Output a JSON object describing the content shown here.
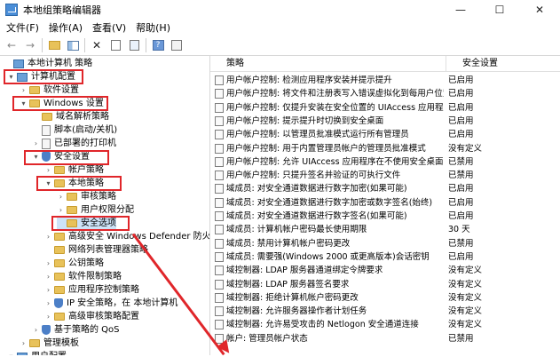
{
  "window": {
    "title": "本地组策略编辑器",
    "minimize": "—",
    "maximize": "☐",
    "close": "✕"
  },
  "menu": [
    "文件(F)",
    "操作(A)",
    "查看(V)",
    "帮助(H)"
  ],
  "toolbar_icons": [
    "back-arrow-icon",
    "forward-arrow-icon",
    "up-folder-icon",
    "show-hide-tree-icon",
    "delete-icon",
    "properties-icon",
    "refresh-icon",
    "help-icon",
    "filter-icon"
  ],
  "tree": [
    {
      "label": "本地计算机 策略",
      "indent": 0,
      "expander": "",
      "icon": "comp"
    },
    {
      "label": "计算机配置",
      "indent": 1,
      "expander": "▾",
      "icon": "comp"
    },
    {
      "label": "软件设置",
      "indent": 2,
      "expander": "›",
      "icon": "fold"
    },
    {
      "label": "Windows 设置",
      "indent": 2,
      "expander": "▾",
      "icon": "fold"
    },
    {
      "label": "域名解析策略",
      "indent": 3,
      "expander": "",
      "icon": "fold"
    },
    {
      "label": "脚本(启动/关机)",
      "indent": 3,
      "expander": "",
      "icon": "doc"
    },
    {
      "label": "已部署的打印机",
      "indent": 3,
      "expander": "›",
      "icon": "doc"
    },
    {
      "label": "安全设置",
      "indent": 3,
      "expander": "▾",
      "icon": "shield"
    },
    {
      "label": "帐户策略",
      "indent": 4,
      "expander": "›",
      "icon": "fold"
    },
    {
      "label": "本地策略",
      "indent": 4,
      "expander": "▾",
      "icon": "fold"
    },
    {
      "label": "审核策略",
      "indent": 5,
      "expander": "›",
      "icon": "fold"
    },
    {
      "label": "用户权限分配",
      "indent": 5,
      "expander": "›",
      "icon": "fold"
    },
    {
      "label": "安全选项",
      "indent": 5,
      "expander": "",
      "icon": "fold",
      "selected": true
    },
    {
      "label": "高级安全 Windows Defender 防火墙",
      "indent": 4,
      "expander": "›",
      "icon": "fold"
    },
    {
      "label": "网络列表管理器策略",
      "indent": 4,
      "expander": "",
      "icon": "fold"
    },
    {
      "label": "公钥策略",
      "indent": 4,
      "expander": "›",
      "icon": "fold"
    },
    {
      "label": "软件限制策略",
      "indent": 4,
      "expander": "›",
      "icon": "fold"
    },
    {
      "label": "应用程序控制策略",
      "indent": 4,
      "expander": "›",
      "icon": "fold"
    },
    {
      "label": "IP 安全策略，在 本地计算机",
      "indent": 4,
      "expander": "›",
      "icon": "shield"
    },
    {
      "label": "高级审核策略配置",
      "indent": 4,
      "expander": "›",
      "icon": "fold"
    },
    {
      "label": "基于策略的 QoS",
      "indent": 3,
      "expander": "›",
      "icon": "shield"
    },
    {
      "label": "管理模板",
      "indent": 2,
      "expander": "›",
      "icon": "fold"
    },
    {
      "label": "用户配置",
      "indent": 1,
      "expander": "▾",
      "icon": "comp"
    }
  ],
  "columns": {
    "policy": "策略",
    "setting": "安全设置"
  },
  "policies": [
    {
      "policy": "用户帐户控制: 检测应用程序安装并提示提升",
      "setting": "已启用"
    },
    {
      "policy": "用户帐户控制: 将文件和注册表写入错误虚拟化到每用户位置",
      "setting": "已启用"
    },
    {
      "policy": "用户帐户控制: 仅提升安装在安全位置的 UIAccess 应用程序",
      "setting": "已启用"
    },
    {
      "policy": "用户帐户控制: 提示提升时切换到安全桌面",
      "setting": "已启用"
    },
    {
      "policy": "用户帐户控制: 以管理员批准模式运行所有管理员",
      "setting": "已启用"
    },
    {
      "policy": "用户帐户控制: 用于内置管理员帐户的管理员批准模式",
      "setting": "没有定义"
    },
    {
      "policy": "用户帐户控制: 允许 UIAccess 应用程序在不使用安全桌面...",
      "setting": "已禁用"
    },
    {
      "policy": "用户帐户控制: 只提升签名并验证的可执行文件",
      "setting": "已禁用"
    },
    {
      "policy": "域成员: 对安全通道数据进行数字加密(如果可能)",
      "setting": "已启用"
    },
    {
      "policy": "域成员: 对安全通道数据进行数字加密或数字签名(始终)",
      "setting": "已启用"
    },
    {
      "policy": "域成员: 对安全通道数据进行数字签名(如果可能)",
      "setting": "已启用"
    },
    {
      "policy": "域成员: 计算机帐户密码最长使用期限",
      "setting": "30 天"
    },
    {
      "policy": "域成员: 禁用计算机帐户密码更改",
      "setting": "已禁用"
    },
    {
      "policy": "域成员: 需要强(Windows 2000 或更高版本)会话密钥",
      "setting": "已启用"
    },
    {
      "policy": "域控制器: LDAP 服务器通道绑定令牌要求",
      "setting": "没有定义"
    },
    {
      "policy": "域控制器: LDAP 服务器签名要求",
      "setting": "没有定义"
    },
    {
      "policy": "域控制器: 拒绝计算机帐户密码更改",
      "setting": "没有定义"
    },
    {
      "policy": "域控制器: 允许服务器操作者计划任务",
      "setting": "没有定义"
    },
    {
      "policy": "域控制器: 允许易受攻击的 Netlogon 安全通道连接",
      "setting": "没有定义"
    },
    {
      "policy": "帐户: 管理员帐户状态",
      "setting": "已禁用"
    }
  ]
}
